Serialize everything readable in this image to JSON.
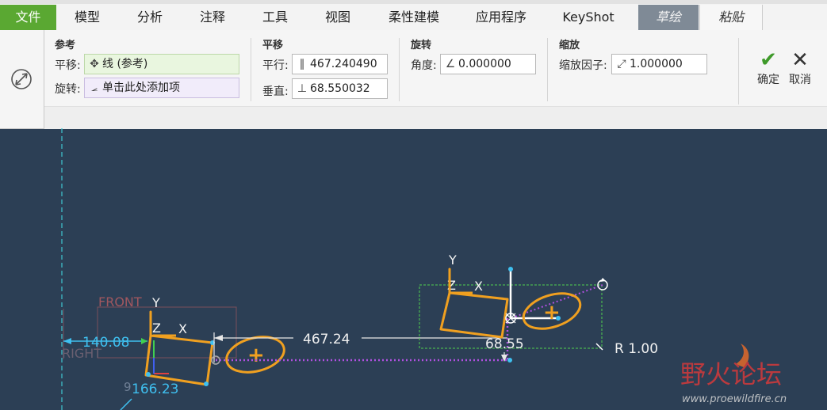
{
  "menu": {
    "tabs": [
      {
        "label": "文件"
      },
      {
        "label": "模型"
      },
      {
        "label": "分析"
      },
      {
        "label": "注释"
      },
      {
        "label": "工具"
      },
      {
        "label": "视图"
      },
      {
        "label": "柔性建模"
      },
      {
        "label": "应用程序"
      },
      {
        "label": "KeyShot"
      },
      {
        "label": "草绘"
      },
      {
        "label": "粘贴"
      }
    ]
  },
  "ribbon": {
    "reference": {
      "title": "参考",
      "translate_label": "平移:",
      "translate_value": "线 (参考)",
      "rotate_label": "旋转:",
      "rotate_value": "单击此处添加项"
    },
    "translation": {
      "title": "平移",
      "parallel_label": "平行:",
      "parallel_value": "467.240490",
      "perpendicular_label": "垂直:",
      "perpendicular_value": "68.550032"
    },
    "rotation": {
      "title": "旋转",
      "angle_label": "角度:",
      "angle_value": "0.000000"
    },
    "scale": {
      "title": "缩放",
      "factor_label": "缩放因子:",
      "factor_value": "1.000000"
    },
    "ok_label": "确定",
    "cancel_label": "取消"
  },
  "canvas": {
    "dim_parallel": "467.24",
    "dim_perpendicular": "68.55",
    "radius": "R 1.00",
    "dim_left_h": "140.08",
    "dim_left_v": "166.23",
    "dim_partial": "9",
    "label_front": "FRONT",
    "label_right": "RIGHT",
    "axis_y": "Y",
    "axis_z": "Z",
    "axis_x": "X"
  },
  "watermark": {
    "title": "野火论坛",
    "url": "www.proewildfire.cn"
  },
  "colors": {
    "canvas_bg": "#2c3f55",
    "sketch_orange": "#f0a020",
    "dimension_cyan": "#3fc0f0",
    "file_tab_green": "#5aa832"
  }
}
